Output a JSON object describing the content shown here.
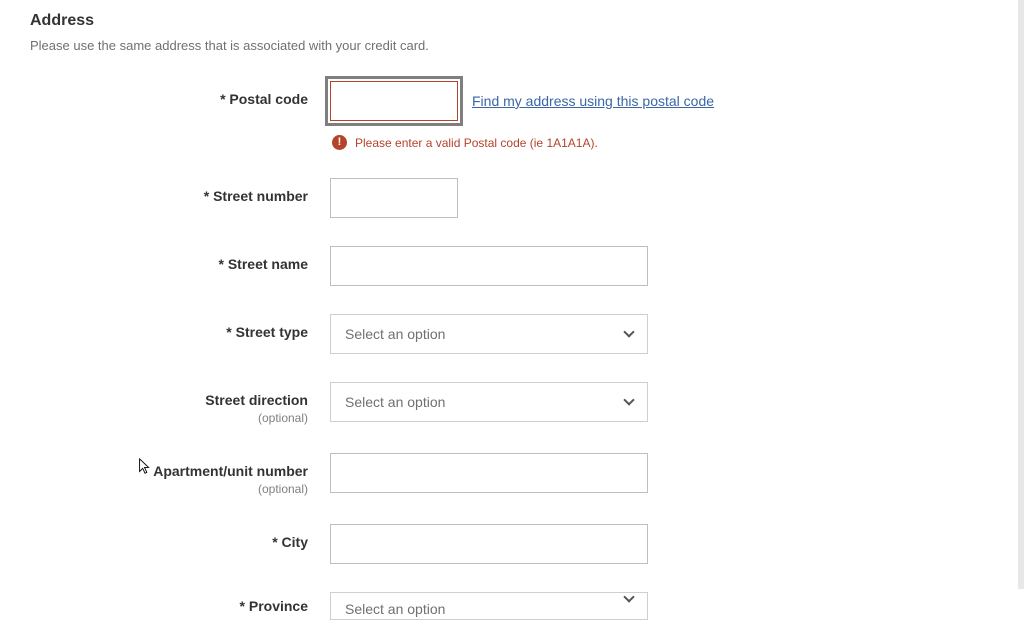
{
  "section": {
    "title": "Address",
    "subtitle": "Please use the same address that is associated with your credit card."
  },
  "fields": {
    "postal_code": {
      "label": "Postal code",
      "value": "",
      "link_text": "Find my address using this postal code",
      "error_text": "Please enter a valid Postal code (ie 1A1A1A)."
    },
    "street_number": {
      "label": "Street number",
      "value": ""
    },
    "street_name": {
      "label": "Street name",
      "value": ""
    },
    "street_type": {
      "label": "Street type",
      "placeholder": "Select an option"
    },
    "street_direction": {
      "label": "Street direction",
      "optional": "(optional)",
      "placeholder": "Select an option"
    },
    "apartment": {
      "label": "Apartment/unit number",
      "optional": "(optional)",
      "value": ""
    },
    "city": {
      "label": "City",
      "value": ""
    },
    "province": {
      "label": "Province",
      "placeholder": "Select an option"
    }
  },
  "required_marker": "* "
}
